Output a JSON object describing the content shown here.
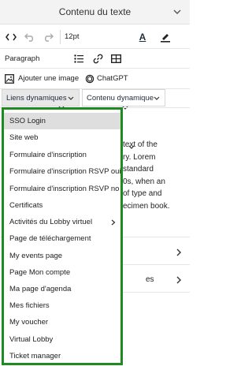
{
  "panel": {
    "title": "Contenu du texte"
  },
  "toolbar": {
    "font_size": "12pt",
    "block_format": "Paragraph",
    "add_image_label": "Ajouter une image",
    "chatgpt_label": "ChatGPT",
    "dynamic_links_label": "Liens dynamiques",
    "dynamic_content_label": "Contenu dynamique",
    "text_color_letter": "A",
    "text_color_hex": "#222222",
    "highlight_color_hex": "#222222"
  },
  "editor": {
    "lines": [
      "text of the",
      "ry. Lorem",
      "standard",
      "0s, when an",
      "of type and",
      "ecimen book."
    ]
  },
  "lower": {
    "row2_text": "es"
  },
  "dropdown": {
    "border_color": "#1e8a21",
    "items": [
      {
        "label": "SSO Login",
        "active": true
      },
      {
        "label": "Site web"
      },
      {
        "label": "Formulaire d'inscription"
      },
      {
        "label": "Formulaire d'inscription RSVP oui"
      },
      {
        "label": "Formulaire d'inscription RSVP no"
      },
      {
        "label": "Certificats"
      },
      {
        "label": "Activités du Lobby virtuel",
        "submenu": true
      },
      {
        "label": "Page de téléchargement"
      },
      {
        "label": "My events page"
      },
      {
        "label": "Page Mon compte"
      },
      {
        "label": "Ma page d'agenda"
      },
      {
        "label": "Mes fichiers"
      },
      {
        "label": "My voucher"
      },
      {
        "label": "Virtual Lobby"
      },
      {
        "label": "Ticket manager"
      }
    ]
  }
}
